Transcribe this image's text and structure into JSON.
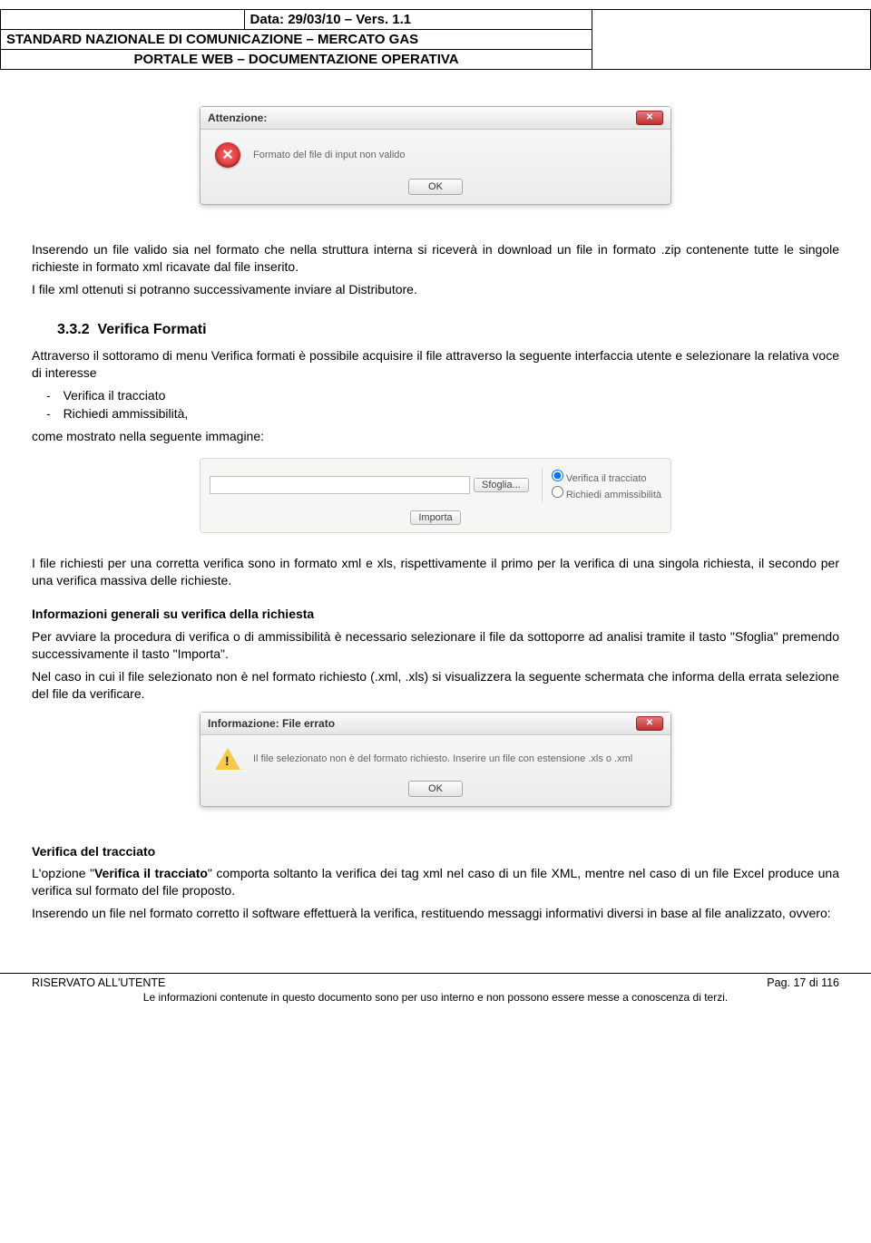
{
  "header": {
    "meta": "Data: 29/03/10 – Vers. 1.1",
    "title1": "STANDARD NAZIONALE DI COMUNICAZIONE – MERCATO GAS",
    "title2": "PORTALE WEB – DOCUMENTAZIONE OPERATIVA"
  },
  "dialog1": {
    "title": "Attenzione:",
    "message": "Formato del file di input non valido",
    "ok": "OK"
  },
  "para1": "Inserendo un file valido sia nel formato che nella struttura interna si riceverà in download un file in formato .zip contenente tutte le singole richieste in formato xml ricavate dal file inserito.",
  "para2": "I file xml ottenuti si potranno successivamente inviare al Distributore.",
  "section": {
    "number": "3.3.2",
    "title": "Verifica Formati",
    "intro": "Attraverso il sottoramo di menu Verifica formati è possibile acquisire il file attraverso la seguente interfaccia utente e selezionare la relativa voce di interesse",
    "items": [
      "Verifica il tracciato",
      "Richiedi ammissibilità,"
    ],
    "after_list": "come mostrato nella seguente immagine:"
  },
  "upload": {
    "browse": "Sfoglia...",
    "radio1": "Verifica il tracciato",
    "radio2": "Richiedi ammissibilità",
    "import": "Importa"
  },
  "para3": "I file richiesti per una corretta verifica sono in formato xml e xls, rispettivamente il primo per la verifica di una singola richiesta, il secondo per una verifica massiva delle richieste.",
  "info_head": "Informazioni generali su verifica della richiesta",
  "para4": "Per avviare la procedura di verifica o di ammissibilità è necessario selezionare il file da sottoporre ad analisi tramite il tasto \"Sfoglia\" premendo successivamente il tasto \"Importa\".",
  "para5": "Nel caso in cui il file selezionato non è nel formato richiesto (.xml, .xls) si visualizzera la seguente schermata che informa della errata selezione del file da verificare.",
  "dialog2": {
    "title": "Informazione: File errato",
    "message": "Il file selezionato non è del formato richiesto. Inserire un file con estensione .xls o .xml",
    "ok": "OK"
  },
  "sub_head": "Verifica del tracciato",
  "para6_pre": "L'opzione \"",
  "para6_bold": "Verifica il tracciato",
  "para6_post": "\" comporta soltanto la verifica dei tag xml nel caso di un file XML, mentre nel caso di un file Excel produce una verifica sul formato del file proposto.",
  "para7": "Inserendo un file nel formato corretto il software effettuerà la verifica, restituendo messaggi informativi diversi in base al file analizzato, ovvero:",
  "footer": {
    "left": "RISERVATO ALL'UTENTE",
    "right": "Pag. 17 di 116",
    "disclaimer": "Le informazioni contenute in questo documento sono per uso interno e non possono essere messe a conoscenza di terzi."
  }
}
